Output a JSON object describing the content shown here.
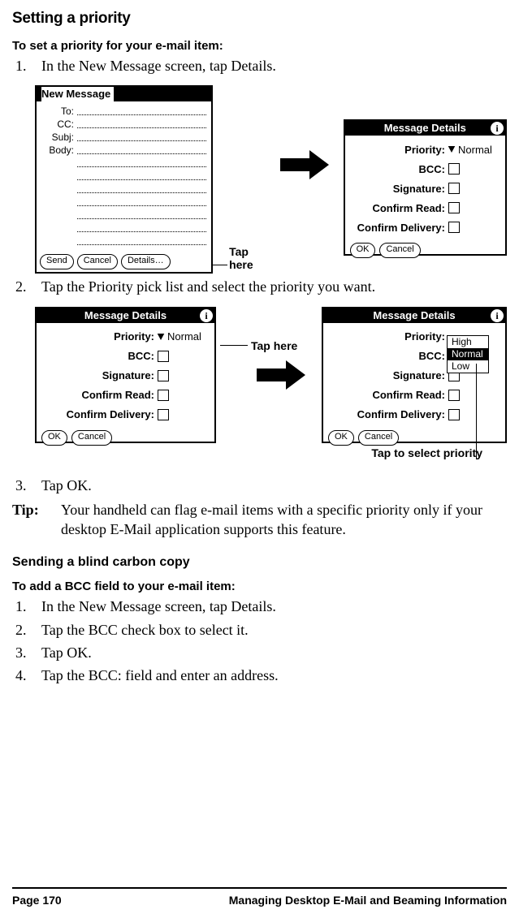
{
  "headings": {
    "h2a": "Setting a priority",
    "h4a": "To set a priority for your e-mail item:",
    "h3a": "Sending a blind carbon copy",
    "h4b": "To add a BCC field to your e-mail item:"
  },
  "steps1": [
    "In the New Message screen, tap Details.",
    "Tap the Priority pick list and select the priority you want.",
    "Tap OK."
  ],
  "steps2": [
    "In the New Message screen, tap Details.",
    "Tap the BCC check box to select it.",
    "Tap OK.",
    "Tap the BCC: field and enter an address."
  ],
  "tip": {
    "label": "Tip:",
    "text": "Your handheld can flag e-mail items with a specific priority only if your desktop E-Mail application supports this feature."
  },
  "newmsg": {
    "title": "New Message",
    "fields": {
      "to": "To:",
      "cc": "CC:",
      "subj": "Subj:",
      "body": "Body:"
    },
    "buttons": {
      "send": "Send",
      "cancel": "Cancel",
      "details": "Details…"
    }
  },
  "msgdet": {
    "title": "Message Details",
    "rows": {
      "priority": "Priority:",
      "bcc": "BCC:",
      "signature": "Signature:",
      "confirm_read": "Confirm Read:",
      "confirm_delivery": "Confirm Delivery:"
    },
    "priority_value": "Normal",
    "buttons": {
      "ok": "OK",
      "cancel": "Cancel"
    },
    "options": [
      "High",
      "Normal",
      "Low"
    ]
  },
  "callouts": {
    "tap_here": "Tap here",
    "tap_select": "Tap to select priority"
  },
  "footer": {
    "page": "Page 170",
    "chapter": "Managing Desktop E-Mail and Beaming Information"
  }
}
